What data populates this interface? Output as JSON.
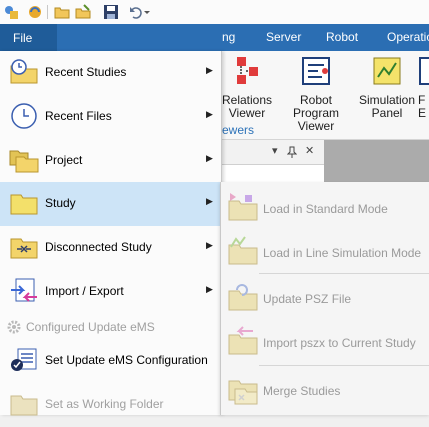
{
  "ribbon": {
    "tabs": [
      "ng",
      "Server",
      "Robot",
      "Operatio"
    ],
    "file_tab": "File",
    "buttons": [
      {
        "label1": "Relations",
        "label2": "Viewer"
      },
      {
        "label1": "Robot Program",
        "label2": "Viewer"
      },
      {
        "label1": "Simulation",
        "label2": "Panel"
      },
      {
        "label1": "F",
        "label2": "E"
      }
    ],
    "group_label": "ewers"
  },
  "quick_access": {
    "icons": [
      "app-icon",
      "refresh-icon",
      "open-folder-icon",
      "edit-folder-icon",
      "save-icon",
      "undo-icon",
      "dropdown-icon"
    ]
  },
  "file_menu": {
    "items": [
      {
        "label": "Recent Studies",
        "icon": "folder-clock-icon",
        "has_submenu": true
      },
      {
        "label": "Recent Files",
        "icon": "clock-icon",
        "has_submenu": true
      },
      {
        "label": "Project",
        "icon": "folders-icon",
        "has_submenu": true
      },
      {
        "label": "Study",
        "icon": "folder-icon",
        "has_submenu": true,
        "selected": true
      },
      {
        "label": "Disconnected Study",
        "icon": "folder-disconnect-icon",
        "has_submenu": true
      },
      {
        "label": "Import / Export",
        "icon": "import-export-icon",
        "has_submenu": true
      }
    ],
    "small_items": [
      {
        "label": "Configured Update eMS",
        "icon": "gear-icon",
        "enabled": false
      },
      {
        "label": "Set Update eMS Configuration",
        "icon": "config-list-icon",
        "enabled": true
      },
      {
        "label": "Set as Working Folder",
        "icon": "working-folder-icon",
        "enabled": false
      }
    ]
  },
  "study_submenu": {
    "items": [
      {
        "label": "Load in Standard Mode",
        "icon": "load-standard-icon"
      },
      {
        "label": "Load in Line Simulation Mode",
        "icon": "load-line-sim-icon"
      },
      {
        "label": "Update PSZ File",
        "icon": "update-psz-icon"
      },
      {
        "label": "Import pszx to Current Study",
        "icon": "import-pszx-icon"
      },
      {
        "label": "Merge Studies",
        "icon": "merge-studies-icon"
      }
    ]
  },
  "panel_buttons": {
    "dropdown": "▾",
    "pin": "📌",
    "close": "✕"
  }
}
